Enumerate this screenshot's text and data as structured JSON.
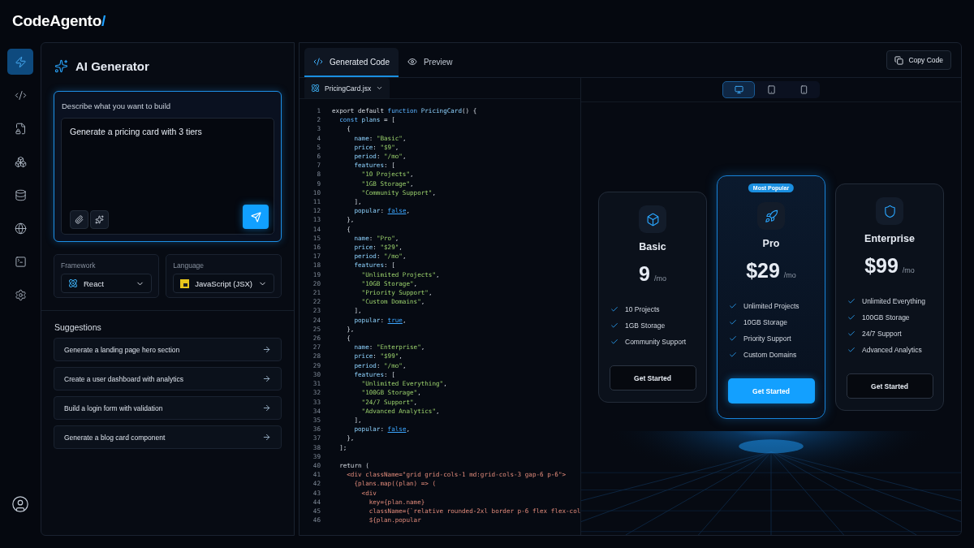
{
  "brand": {
    "name": "CodeAgento",
    "mark": "/"
  },
  "nav": [
    {
      "selected": true
    },
    {
      "selected": false
    },
    {
      "selected": false
    },
    {
      "selected": false
    },
    {
      "selected": false
    },
    {
      "selected": false
    },
    {
      "selected": false
    },
    {
      "selected": false
    }
  ],
  "generator": {
    "title": "AI Generator",
    "prompt_label": "Describe what you want to build",
    "prompt_value": "Generate a pricing card with 3 tiers",
    "framework": {
      "label": "Framework",
      "value": "React"
    },
    "language": {
      "label": "Language",
      "value": "JavaScript (JSX)"
    },
    "suggestions_title": "Suggestions",
    "suggestions": [
      "Generate a landing page hero section",
      "Create a user dashboard with analytics",
      "Build a login form with validation",
      "Generate a blog card component"
    ]
  },
  "tabs": [
    {
      "label": "Generated Code",
      "selected": true
    },
    {
      "label": "Preview",
      "selected": false
    }
  ],
  "copy_button": "Copy Code",
  "file_tab": "PricingCard.jsx",
  "code": [
    {
      "n": "1",
      "tokens": [
        {
          "text": "export default ",
          "kind": "plain"
        },
        {
          "text": "function",
          "kind": "keyword"
        },
        {
          "text": " PricingCard",
          "kind": "func"
        },
        {
          "text": "() {",
          "kind": "plain"
        }
      ]
    },
    {
      "n": "2",
      "tokens": [
        {
          "text": "  const",
          "kind": "keyword"
        },
        {
          "text": " plans",
          "kind": "func"
        },
        {
          "text": " = [",
          "kind": "plain"
        }
      ]
    },
    {
      "n": "3",
      "tokens": [
        {
          "text": "    {",
          "kind": "plain"
        }
      ]
    },
    {
      "n": "4",
      "tokens": [
        {
          "text": "      name",
          "kind": "prop"
        },
        {
          "text": ": ",
          "kind": "plain"
        },
        {
          "text": "\"Basic\"",
          "kind": "string"
        },
        {
          "text": ",",
          "kind": "plain"
        }
      ]
    },
    {
      "n": "5",
      "tokens": [
        {
          "text": "      price",
          "kind": "prop"
        },
        {
          "text": ": ",
          "kind": "plain"
        },
        {
          "text": "\"$9\"",
          "kind": "string"
        },
        {
          "text": ",",
          "kind": "plain"
        }
      ]
    },
    {
      "n": "6",
      "tokens": [
        {
          "text": "      period",
          "kind": "prop"
        },
        {
          "text": ": ",
          "kind": "plain"
        },
        {
          "text": "\"/mo\"",
          "kind": "string"
        },
        {
          "text": ",",
          "kind": "plain"
        }
      ]
    },
    {
      "n": "7",
      "tokens": [
        {
          "text": "      features",
          "kind": "prop"
        },
        {
          "text": ": [",
          "kind": "plain"
        }
      ]
    },
    {
      "n": "8",
      "tokens": [
        {
          "text": "        \"10 Projects\"",
          "kind": "string"
        },
        {
          "text": ",",
          "kind": "plain"
        }
      ]
    },
    {
      "n": "9",
      "tokens": [
        {
          "text": "        \"1GB Storage\"",
          "kind": "string"
        },
        {
          "text": ",",
          "kind": "plain"
        }
      ]
    },
    {
      "n": "10",
      "tokens": [
        {
          "text": "        \"Community Support\"",
          "kind": "string"
        },
        {
          "text": ",",
          "kind": "plain"
        }
      ]
    },
    {
      "n": "11",
      "tokens": [
        {
          "text": "      ],",
          "kind": "plain"
        }
      ]
    },
    {
      "n": "12",
      "tokens": [
        {
          "text": "      popular",
          "kind": "prop"
        },
        {
          "text": ": ",
          "kind": "plain"
        },
        {
          "text": "false",
          "kind": "bool"
        },
        {
          "text": ",",
          "kind": "plain"
        }
      ]
    },
    {
      "n": "13",
      "tokens": [
        {
          "text": "    },",
          "kind": "plain"
        }
      ]
    },
    {
      "n": "14",
      "tokens": [
        {
          "text": "    {",
          "kind": "plain"
        }
      ]
    },
    {
      "n": "15",
      "tokens": [
        {
          "text": "      name",
          "kind": "prop"
        },
        {
          "text": ": ",
          "kind": "plain"
        },
        {
          "text": "\"Pro\"",
          "kind": "string"
        },
        {
          "text": ",",
          "kind": "plain"
        }
      ]
    },
    {
      "n": "16",
      "tokens": [
        {
          "text": "      price",
          "kind": "prop"
        },
        {
          "text": ": ",
          "kind": "plain"
        },
        {
          "text": "\"$29\"",
          "kind": "string"
        },
        {
          "text": ",",
          "kind": "plain"
        }
      ]
    },
    {
      "n": "17",
      "tokens": [
        {
          "text": "      period",
          "kind": "prop"
        },
        {
          "text": ": ",
          "kind": "plain"
        },
        {
          "text": "\"/mo\"",
          "kind": "string"
        },
        {
          "text": ",",
          "kind": "plain"
        }
      ]
    },
    {
      "n": "18",
      "tokens": [
        {
          "text": "      features",
          "kind": "prop"
        },
        {
          "text": ": [",
          "kind": "plain"
        }
      ]
    },
    {
      "n": "19",
      "tokens": [
        {
          "text": "        \"Unlimited Projects\"",
          "kind": "string"
        },
        {
          "text": ",",
          "kind": "plain"
        }
      ]
    },
    {
      "n": "20",
      "tokens": [
        {
          "text": "        \"10GB Storage\"",
          "kind": "string"
        },
        {
          "text": ",",
          "kind": "plain"
        }
      ]
    },
    {
      "n": "21",
      "tokens": [
        {
          "text": "        \"Priority Support\"",
          "kind": "string"
        },
        {
          "text": ",",
          "kind": "plain"
        }
      ]
    },
    {
      "n": "22",
      "tokens": [
        {
          "text": "        \"Custom Domains\"",
          "kind": "string"
        },
        {
          "text": ",",
          "kind": "plain"
        }
      ]
    },
    {
      "n": "23",
      "tokens": [
        {
          "text": "      ],",
          "kind": "plain"
        }
      ]
    },
    {
      "n": "24",
      "tokens": [
        {
          "text": "      popular",
          "kind": "prop"
        },
        {
          "text": ": ",
          "kind": "plain"
        },
        {
          "text": "true",
          "kind": "bool"
        },
        {
          "text": ",",
          "kind": "plain"
        }
      ]
    },
    {
      "n": "25",
      "tokens": [
        {
          "text": "    },",
          "kind": "plain"
        }
      ]
    },
    {
      "n": "26",
      "tokens": [
        {
          "text": "    {",
          "kind": "plain"
        }
      ]
    },
    {
      "n": "27",
      "tokens": [
        {
          "text": "      name",
          "kind": "prop"
        },
        {
          "text": ": ",
          "kind": "plain"
        },
        {
          "text": "\"Enterprise\"",
          "kind": "string"
        },
        {
          "text": ",",
          "kind": "plain"
        }
      ]
    },
    {
      "n": "28",
      "tokens": [
        {
          "text": "      price",
          "kind": "prop"
        },
        {
          "text": ": ",
          "kind": "plain"
        },
        {
          "text": "\"$99\"",
          "kind": "string"
        },
        {
          "text": ",",
          "kind": "plain"
        }
      ]
    },
    {
      "n": "29",
      "tokens": [
        {
          "text": "      period",
          "kind": "prop"
        },
        {
          "text": ": ",
          "kind": "plain"
        },
        {
          "text": "\"/mo\"",
          "kind": "string"
        },
        {
          "text": ",",
          "kind": "plain"
        }
      ]
    },
    {
      "n": "30",
      "tokens": [
        {
          "text": "      features",
          "kind": "prop"
        },
        {
          "text": ": [",
          "kind": "plain"
        }
      ]
    },
    {
      "n": "31",
      "tokens": [
        {
          "text": "        \"Unlimited Everything\"",
          "kind": "string"
        },
        {
          "text": ",",
          "kind": "plain"
        }
      ]
    },
    {
      "n": "32",
      "tokens": [
        {
          "text": "        \"100GB Storage\"",
          "kind": "string"
        },
        {
          "text": ",",
          "kind": "plain"
        }
      ]
    },
    {
      "n": "33",
      "tokens": [
        {
          "text": "        \"24/7 Support\"",
          "kind": "string"
        },
        {
          "text": ",",
          "kind": "plain"
        }
      ]
    },
    {
      "n": "34",
      "tokens": [
        {
          "text": "        \"Advanced Analytics\"",
          "kind": "string"
        },
        {
          "text": ",",
          "kind": "plain"
        }
      ]
    },
    {
      "n": "35",
      "tokens": [
        {
          "text": "      ],",
          "kind": "plain"
        }
      ]
    },
    {
      "n": "36",
      "tokens": [
        {
          "text": "      popular",
          "kind": "prop"
        },
        {
          "text": ": ",
          "kind": "plain"
        },
        {
          "text": "false",
          "kind": "bool"
        },
        {
          "text": ",",
          "kind": "plain"
        }
      ]
    },
    {
      "n": "37",
      "tokens": [
        {
          "text": "    },",
          "kind": "plain"
        }
      ]
    },
    {
      "n": "38",
      "tokens": [
        {
          "text": "  ];",
          "kind": "plain"
        }
      ]
    },
    {
      "n": "39"
    },
    {
      "n": "40",
      "tokens": [
        {
          "text": "  return (",
          "kind": "plain"
        }
      ]
    },
    {
      "n": "41",
      "tokens": [
        {
          "text": "    <div className=\"grid grid-cols-1 md:grid-cols-3 gap-6 p-6\">",
          "kind": "tag"
        }
      ]
    },
    {
      "n": "42",
      "tokens": [
        {
          "text": "      {plans.map((plan) => (",
          "kind": "tag"
        }
      ]
    },
    {
      "n": "43",
      "tokens": [
        {
          "text": "        <div",
          "kind": "tag"
        }
      ]
    },
    {
      "n": "44",
      "tokens": [
        {
          "text": "          key={plan.name}",
          "kind": "tag"
        }
      ]
    },
    {
      "n": "45",
      "tokens": [
        {
          "text": "          className={`relative rounded-2xl border p-6 flex flex-col",
          "kind": "tag"
        }
      ]
    },
    {
      "n": "46",
      "tokens": [
        {
          "text": "          ${plan.popular",
          "kind": "tag"
        }
      ]
    }
  ],
  "devices": [
    {
      "selected": true
    },
    {
      "selected": false
    },
    {
      "selected": false
    }
  ],
  "plans": [
    {
      "name": "Basic",
      "price": "9",
      "period": "/mo",
      "features": [
        "10 Projects",
        "1GB Storage",
        "Community Support"
      ],
      "popular": false,
      "button": "Get Started"
    },
    {
      "name": "Pro",
      "price": "$29",
      "period": "/mo",
      "features": [
        "Unlimited Projects",
        "10GB Storage",
        "Priority Support",
        "Custom Domains"
      ],
      "popular": true,
      "badge": "Most Popular",
      "button": "Get Started"
    },
    {
      "name": "Enterprise",
      "price": "$99",
      "period": "/mo",
      "features": [
        "Unlimited Everything",
        "100GB Storage",
        "24/7 Support",
        "Advanced Analytics"
      ],
      "popular": false,
      "button": "Get Started"
    }
  ]
}
